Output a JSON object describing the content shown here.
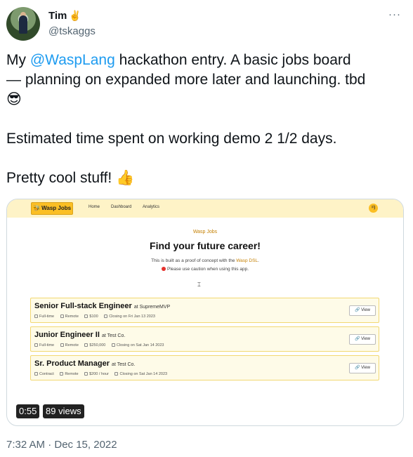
{
  "author": {
    "name": "Tim",
    "name_emoji": "✌️",
    "handle": "@tskaggs"
  },
  "more_label": "···",
  "tweet": {
    "line1_prefix": "My ",
    "mention": "@WaspLang",
    "line1_suffix": " hackathon entry. A basic jobs board",
    "line2": "— planning on expanded more later and launching. tbd",
    "line3_emoji": "😎",
    "line4": "Estimated time spent on working demo 2 1/2 days.",
    "line5": "Pretty cool stuff! 👍"
  },
  "app": {
    "brand": "🐝 Wasp Jobs",
    "nav": [
      "Home",
      "Dashboard",
      "Analytics"
    ],
    "smiley": "=)",
    "hero_small": "Wasp Jobs",
    "hero_title": "Find your future career!",
    "hero_desc_prefix": "This is built as a proof of concept with the ",
    "hero_desc_link": "Wasp DSL",
    "hero_desc_suffix": ".",
    "hero_caution": "Please use caution when using this app.",
    "view_label": "View",
    "jobs": [
      {
        "title": "Senior Full-stack Engineer",
        "at": "at SupremeMVP",
        "type": "Full-time",
        "location": "Remote",
        "pay": "$100",
        "closing": "Closing on Fri Jan 13 2023"
      },
      {
        "title": "Junior Engineer II",
        "at": "at Test Co.",
        "type": "Full-time",
        "location": "Remote",
        "pay": "$250,000",
        "closing": "Closing on Sat Jan 14 2023"
      },
      {
        "title": "Sr. Product Manager",
        "at": "at Test Co.",
        "type": "Contract",
        "location": "Remote",
        "pay": "$200 / hour",
        "closing": "Closing on Sat Jan 14 2023"
      }
    ]
  },
  "video": {
    "duration": "0:55",
    "views": "89 views"
  },
  "timestamp": "7:32 AM · Dec 15, 2022",
  "colors": {
    "mention": "#1d9bf0",
    "secondary_text": "#536471",
    "nav_bg": "#fef3c7",
    "brand_bg": "#fbbf24",
    "job_bg": "#fefbe8"
  }
}
